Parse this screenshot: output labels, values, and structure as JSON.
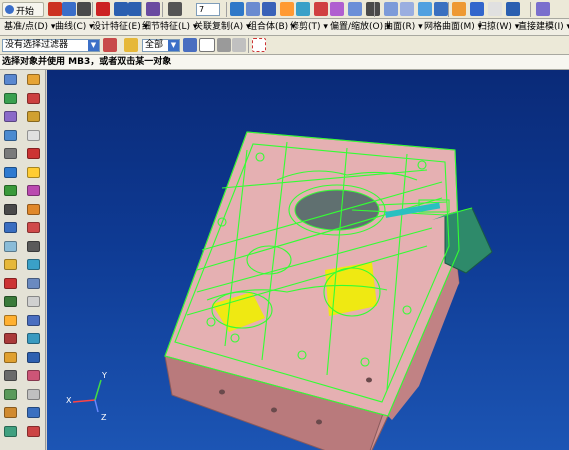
{
  "toolbar1": {
    "start_label": "开始",
    "colors": [
      "#cc3322",
      "#3a6ec9",
      "#4a4a4a",
      "#cc2222",
      "#2b5fb0",
      "#2b5fb0",
      "#6a4aa0",
      "#555555",
      "#2f78c8",
      "#6a8bd0",
      "#3a62b8",
      "#ff9a33",
      "#3aa0c8",
      "#d04040",
      "#b05fd0",
      "#6b8fd8",
      "#4a4a4a",
      "#7d9bd9",
      "#9aaee0",
      "#50a0e0",
      "#3a70c0",
      "#ee9933",
      "#3366cc",
      "#e0e0e0",
      "#2b5fb0",
      "#7a6fcd"
    ],
    "number_value": "7"
  },
  "menu": {
    "items": [
      "基准/点(D) ▾",
      "曲线(C) ▾",
      "设计特征(E) ▾",
      "细节特征(L) ▾",
      "关联复制(A) ▾",
      "组合体(B) ▾",
      "修剪(T) ▾",
      "偏置/缩放(O) ▾",
      "曲面(R) ▾",
      "网格曲面(M) ▾",
      "扫掠(W) ▾",
      "直接建模(I) ▾"
    ]
  },
  "toolbar2": {
    "filter_value": "没有选择过滤器",
    "scope_value": "全部"
  },
  "status": {
    "prompt": "选择对象并使用 MB3，或者双击某一对象"
  },
  "left_toolbar": {
    "colors": [
      "#5a88d0",
      "#e6a435",
      "#3aa050",
      "#cc4040",
      "#8a6ac8",
      "#d0a030",
      "#4a8ad0",
      "#e0e0e0",
      "#7a7a7a",
      "#cc3333",
      "#2e7ad0",
      "#ffcc33",
      "#3a9a3a",
      "#ba4ab0",
      "#4a4a4a",
      "#e0882a",
      "#3a6ec0",
      "#d04a4a",
      "#8abcd8",
      "#5a5a5a",
      "#e6b83a",
      "#3aa0c8",
      "#cc3333",
      "#6a8ac0",
      "#3a7a3a",
      "#d0d0d0",
      "#ffb030",
      "#4a6ec0",
      "#aa3a3a",
      "#3a9ac0",
      "#e0a030",
      "#2e60b0",
      "#6a6a6a",
      "#cc5577",
      "#5a9a5a",
      "#c0c0c0",
      "#d08a30",
      "#3a70c0",
      "#40a080",
      "#cc4444"
    ],
    "cube_colors": [
      "#3a5ec8",
      "#e0a030",
      "#7a4ab8",
      "#e04040",
      "#2e8ad0",
      "#c060a0"
    ]
  },
  "viewport": {
    "triad": {
      "x_label": "X",
      "y_label": "Y",
      "z_label": "Z"
    },
    "colors": {
      "plate_top": "#e5b0b2",
      "plate_side": "#cc8f90",
      "plate_front": "#b97a7c",
      "wire": "#33ff33",
      "yellow": "#f0f000",
      "dark_part": "#607070",
      "green_block": "#2e8a6a",
      "teal": "#2ac0c0"
    }
  }
}
